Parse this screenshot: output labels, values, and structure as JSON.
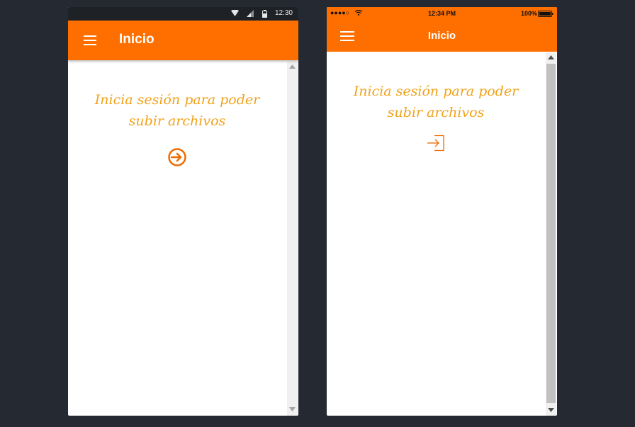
{
  "colors": {
    "background": "#252a32",
    "primary": "#ff6f00",
    "text_accent": "#f1a21a",
    "status_bar_android": "#1e2126"
  },
  "android": {
    "status_bar": {
      "time": "12:30",
      "icons": [
        "wifi-icon",
        "signal-icon",
        "battery-icon"
      ]
    },
    "app_bar": {
      "menu_icon": "hamburger-menu-icon",
      "title": "Inicio"
    },
    "content": {
      "message": "Inicia sesión para poder subir archivos",
      "login_icon": "login-circle-arrow-icon"
    }
  },
  "ios": {
    "status_bar": {
      "carrier": "●●●●○",
      "time": "12:34 PM",
      "battery": "100%",
      "icons": [
        "wifi-icon",
        "battery-icon"
      ]
    },
    "nav_bar": {
      "menu_icon": "hamburger-menu-icon",
      "title": "Inicio"
    },
    "content": {
      "message": "Inicia sesión para poder subir archivos",
      "login_icon": "login-arrow-box-icon"
    }
  }
}
